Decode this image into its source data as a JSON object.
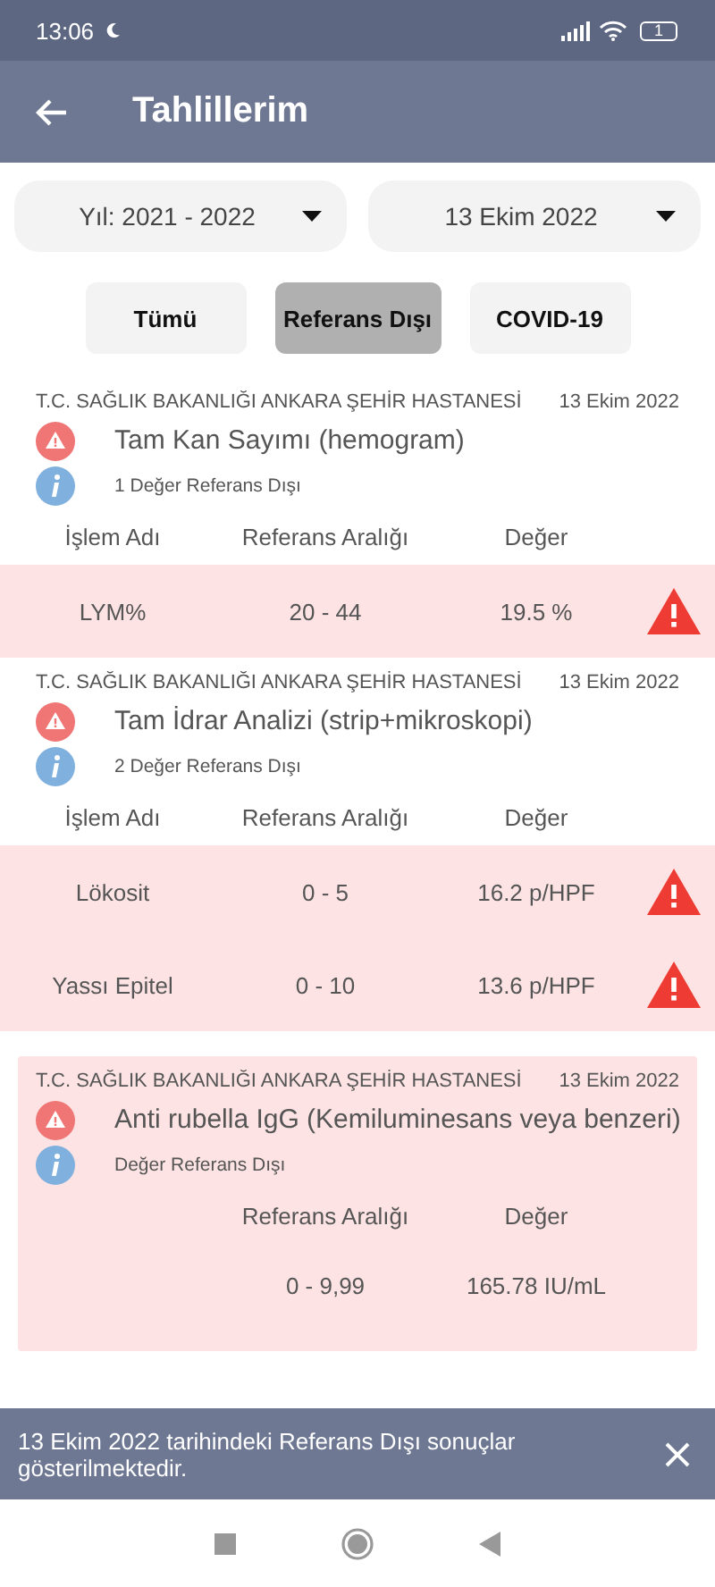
{
  "status_bar": {
    "time": "13:06",
    "battery": "1"
  },
  "app_bar": {
    "title": "Tahlillerim"
  },
  "dropdowns": [
    {
      "value": "Yıl: 2021 - 2022"
    },
    {
      "value": "13 Ekim 2022"
    }
  ],
  "filters": [
    {
      "label": "Tümü",
      "selected": false
    },
    {
      "label": "Referans Dışı",
      "selected": true
    },
    {
      "label": "COVID-19",
      "selected": false
    }
  ],
  "tests": [
    {
      "hospital": "T.C. SAĞLIK BAKANLIĞI ANKARA ŞEHİR HASTANESİ",
      "date": "13 Ekim 2022",
      "name": "Tam Kan Sayımı (hemogram)",
      "summary": "1 Değer Referans Dışı",
      "highlighted": false,
      "columns": [
        {
          "kind": "name",
          "label": "İşlem Adı"
        },
        {
          "kind": "range",
          "label": "Referans Aralığı"
        },
        {
          "kind": "value",
          "label": "Değer"
        }
      ],
      "rows": [
        {
          "name": "LYM%",
          "range": "20 - 44",
          "value": "19.5 %",
          "flagged": true
        }
      ]
    },
    {
      "hospital": "T.C. SAĞLIK BAKANLIĞI ANKARA ŞEHİR HASTANESİ",
      "date": "13 Ekim 2022",
      "name": "Tam İdrar Analizi (strip+mikroskopi)",
      "summary": "2 Değer Referans Dışı",
      "highlighted": false,
      "columns": [
        {
          "kind": "name",
          "label": "İşlem Adı"
        },
        {
          "kind": "range",
          "label": "Referans Aralığı"
        },
        {
          "kind": "value",
          "label": "Değer"
        }
      ],
      "rows": [
        {
          "name": "Lökosit",
          "range": "0 - 5",
          "value": "16.2 p/HPF",
          "flagged": true
        },
        {
          "name": "Yassı Epitel",
          "range": "0 - 10",
          "value": "13.6 p/HPF",
          "flagged": true
        }
      ]
    },
    {
      "hospital": "T.C. SAĞLIK BAKANLIĞI ANKARA ŞEHİR HASTANESİ",
      "date": "13 Ekim 2022",
      "name": "Anti rubella IgG (Kemiluminesans veya benzeri)",
      "summary": "Değer Referans Dışı",
      "highlighted": true,
      "columns": [
        {
          "kind": "range",
          "label": "Referans Aralığı"
        },
        {
          "kind": "value",
          "label": "Değer"
        }
      ],
      "rows": [
        {
          "range": "0 - 9,99",
          "value": "165.78 IU/mL",
          "flagged": false
        }
      ]
    }
  ],
  "snackbar": {
    "message": "13 Ekim 2022 tarihindeki Referans Dışı sonuçlar gösterilmektedir."
  }
}
